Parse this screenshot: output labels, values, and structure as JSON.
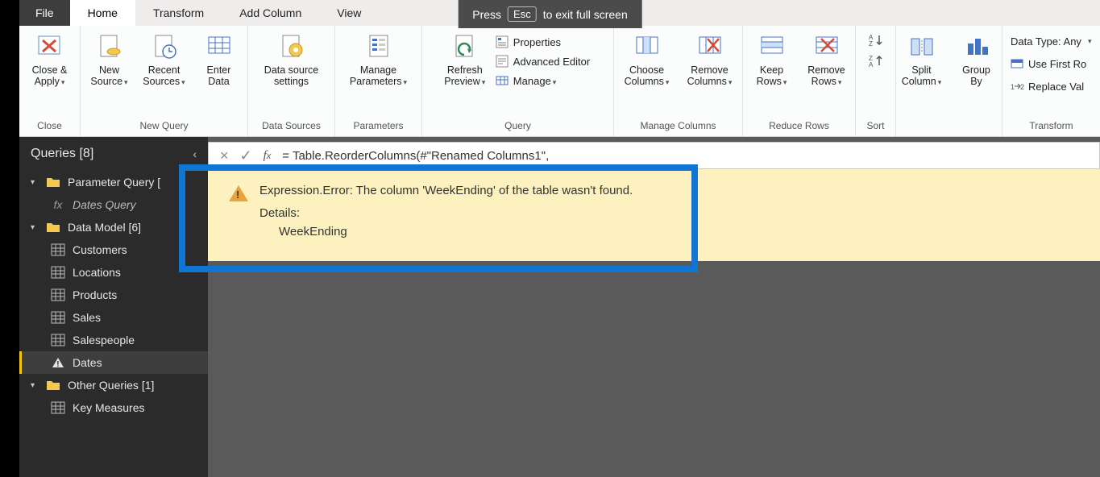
{
  "fullscreen_notice": {
    "pre": "Press",
    "key": "Esc",
    "post": "to exit full screen"
  },
  "tabs": {
    "file": "File",
    "home": "Home",
    "transform": "Transform",
    "add_column": "Add Column",
    "view": "View"
  },
  "ribbon": {
    "close": {
      "label": "Close &\nApply",
      "group": "Close"
    },
    "new_query": {
      "new_source": "New\nSource",
      "recent_sources": "Recent\nSources",
      "enter_data": "Enter\nData",
      "group": "New Query"
    },
    "data_sources": {
      "settings": "Data source\nsettings",
      "group": "Data Sources"
    },
    "parameters": {
      "manage": "Manage\nParameters",
      "group": "Parameters"
    },
    "query": {
      "refresh": "Refresh\nPreview",
      "properties": "Properties",
      "advanced": "Advanced Editor",
      "manage": "Manage",
      "group": "Query"
    },
    "manage_columns": {
      "choose": "Choose\nColumns",
      "remove": "Remove\nColumns",
      "group": "Manage Columns"
    },
    "reduce_rows": {
      "keep": "Keep\nRows",
      "remove": "Remove\nRows",
      "group": "Reduce Rows"
    },
    "sort": {
      "group": "Sort"
    },
    "split_group": {
      "split": "Split\nColumn",
      "groupby": "Group\nBy"
    },
    "transform": {
      "data_type": "Data Type: Any",
      "first_row": "Use First Ro",
      "replace": "Replace Val",
      "group": "Transform"
    }
  },
  "queries": {
    "title": "Queries [8]",
    "groups": {
      "param": "Parameter Query [",
      "dates_query": "Dates Query",
      "data_model": "Data Model [6]",
      "items": [
        "Customers",
        "Locations",
        "Products",
        "Sales",
        "Salespeople",
        "Dates"
      ],
      "other": "Other Queries [1]",
      "key_measures": "Key Measures"
    }
  },
  "formula": {
    "text": "= Table.ReorderColumns(#\"Renamed Columns1\","
  },
  "error": {
    "message": "Expression.Error: The column 'WeekEnding' of the table wasn't found.",
    "details_label": "Details:",
    "column": "WeekEnding"
  }
}
